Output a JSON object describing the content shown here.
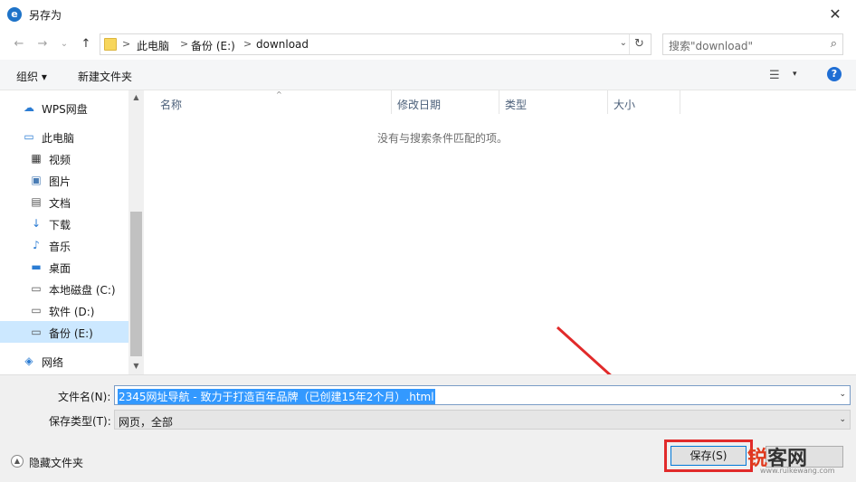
{
  "window": {
    "title": "另存为",
    "close_glyph": "✕"
  },
  "nav": {
    "back_glyph": "←",
    "forward_glyph": "→",
    "history_glyph": "⌄",
    "up_glyph": "↑"
  },
  "breadcrumb": {
    "items": [
      {
        "label": "此电脑"
      },
      {
        "label": "备份 (E:)"
      },
      {
        "label": "download"
      }
    ],
    "separator": ">",
    "dropdown_glyph": "⌄",
    "refresh_glyph": "↻"
  },
  "search": {
    "placeholder": "搜索\"download\"",
    "icon_glyph": "⌕"
  },
  "toolbar": {
    "organize_label": "组织 ▾",
    "new_folder_label": "新建文件夹",
    "view_glyph": "☰",
    "view_drop_glyph": "▾",
    "help_glyph": "?"
  },
  "sidebar": {
    "items": [
      {
        "label": "WPS网盘",
        "icon": "☁",
        "color": "#2b7cd3"
      },
      {
        "label": "此电脑",
        "icon": "▭",
        "color": "#2b7cd3"
      },
      {
        "label": "视频",
        "icon": "▦",
        "color": "#333333"
      },
      {
        "label": "图片",
        "icon": "▣",
        "color": "#4a7db5"
      },
      {
        "label": "文档",
        "icon": "▤",
        "color": "#555555"
      },
      {
        "label": "下载",
        "icon": "↓",
        "color": "#2b7cd3"
      },
      {
        "label": "音乐",
        "icon": "♪",
        "color": "#2b7cd3"
      },
      {
        "label": "桌面",
        "icon": "▬",
        "color": "#2b7cd3"
      },
      {
        "label": "本地磁盘 (C:)",
        "icon": "▭",
        "color": "#555555"
      },
      {
        "label": "软件 (D:)",
        "icon": "▭",
        "color": "#555555"
      },
      {
        "label": "备份 (E:)",
        "icon": "▭",
        "color": "#555555"
      },
      {
        "label": "网络",
        "icon": "◈",
        "color": "#2b7cd3"
      }
    ],
    "selected_index": 10,
    "scroll_up_glyph": "▲",
    "scroll_down_glyph": "▼"
  },
  "file_list": {
    "columns": [
      "名称",
      "修改日期",
      "类型",
      "大小"
    ],
    "sort_caret": "^",
    "empty_message": "没有与搜索条件匹配的项。"
  },
  "form": {
    "filename_label": "文件名(N):",
    "filename_value": "2345网址导航 - 致力于打造百年品牌（已创建15年2个月）.html",
    "filetype_label": "保存类型(T):",
    "filetype_value": "网页，全部",
    "dropdown_glyph": "⌄",
    "hide_folders_label": "隐藏文件夹",
    "hide_icon_glyph": "▲",
    "save_label": "保存(S)"
  },
  "annotation": {
    "arrow_color": "#e12a2a",
    "highlight_color": "#e12a2a"
  },
  "watermark": {
    "text_a": "锐",
    "text_b": "客网",
    "url": "www.ruikewang.com"
  }
}
